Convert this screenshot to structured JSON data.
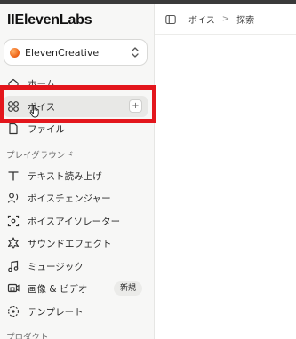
{
  "app": {
    "logo": "IIElevenLabs"
  },
  "workspace": {
    "name": "ElevenCreative"
  },
  "sidebar": {
    "items": [
      {
        "label": "ホーム",
        "icon": "home-icon"
      },
      {
        "label": "ボイス",
        "icon": "voices-icon",
        "active": true
      },
      {
        "label": "ファイル",
        "icon": "file-icon"
      }
    ],
    "section_playground": "プレイグラウンド",
    "playground_items": [
      {
        "label": "テキスト読み上げ",
        "icon": "text-to-speech-icon"
      },
      {
        "label": "ボイスチェンジャー",
        "icon": "voice-changer-icon"
      },
      {
        "label": "ボイスアイソレーター",
        "icon": "voice-isolator-icon"
      },
      {
        "label": "サウンドエフェクト",
        "icon": "sound-effects-icon"
      },
      {
        "label": "ミュージック",
        "icon": "music-icon"
      },
      {
        "label": "画像 & ビデオ",
        "icon": "image-video-icon",
        "badge": "新規"
      },
      {
        "label": "テンプレート",
        "icon": "templates-icon"
      }
    ],
    "section_products": "プロダクト",
    "add_symbol": "+"
  },
  "breadcrumb": {
    "parent": "ボイス",
    "separator": ">",
    "current": "探索"
  },
  "colors": {
    "highlight": "#e3161c",
    "sidebar_bg": "#f7f7f6",
    "accent": "#f06a1d"
  }
}
